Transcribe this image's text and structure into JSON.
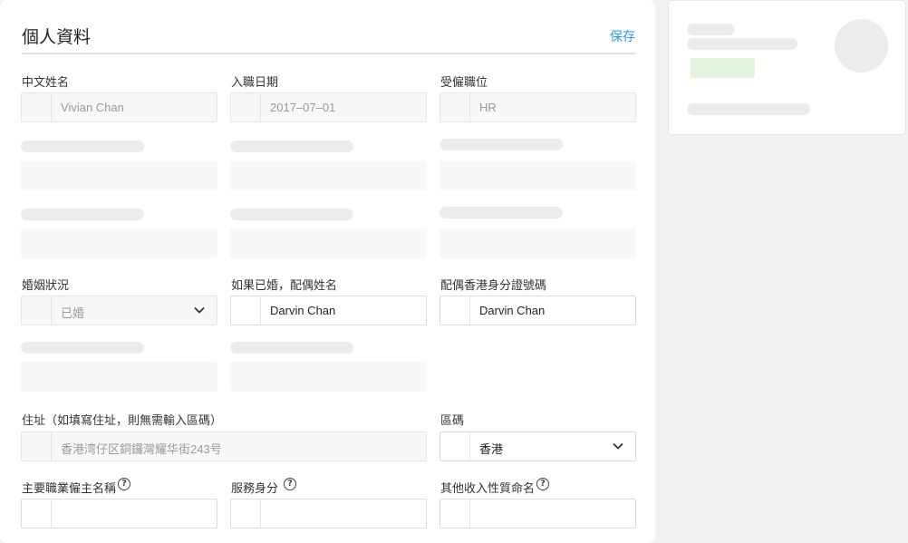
{
  "header": {
    "title": "個人資料",
    "save_label": "保存"
  },
  "fields": {
    "chinese_name": {
      "label": "中文姓名",
      "value": "Vivian Chan"
    },
    "join_date": {
      "label": "入職日期",
      "value": "2017–07–01"
    },
    "position": {
      "label": "受僱職位",
      "value": "HR"
    },
    "marital_status": {
      "label": "婚姻狀況",
      "value": "已婚"
    },
    "spouse_name": {
      "label": "如果已婚，配偶姓名",
      "value": "Darvin Chan"
    },
    "spouse_id": {
      "label": "配偶香港身分證號碼",
      "value": "Darvin Chan"
    },
    "address": {
      "label": "住址（如填寫住址，則無需輸入區碼）",
      "value": "香港湾仔区銅鑼灣耀华街243号"
    },
    "district": {
      "label": "區碼",
      "value": "香港"
    },
    "employer_name": {
      "label": "主要職業僱主名稱"
    },
    "service_capacity": {
      "label": "服務身分"
    },
    "other_income": {
      "label": "其他收入性質命名"
    }
  },
  "icons": {
    "help": "help-circle-icon",
    "dropdown": "chevron-down-icon"
  },
  "help_glyph": "?",
  "colors": {
    "accent": "#2a9ae0",
    "skeleton": "#ececec",
    "input_disabled_bg": "#f7f8fa",
    "tag_green": "#e4f3dd"
  }
}
